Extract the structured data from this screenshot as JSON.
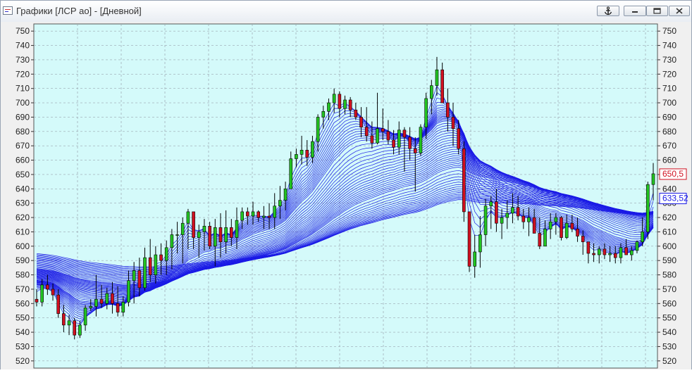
{
  "window": {
    "title": "Графики [ЛСР ао] - [Дневной]",
    "anchor_icon": "anchor-icon",
    "minimize_icon": "minimize-icon",
    "restore_icon": "restore-icon",
    "close_icon": "close-icon"
  },
  "chart_data": {
    "type": "candlestick",
    "ylim": [
      515,
      755
    ],
    "y_ticks": [
      520,
      530,
      540,
      550,
      560,
      570,
      580,
      590,
      600,
      610,
      620,
      630,
      640,
      650,
      660,
      670,
      680,
      690,
      700,
      710,
      720,
      730,
      740,
      750
    ],
    "grid": true,
    "colors": {
      "background": "#d4fafa",
      "up": "#22c422",
      "down": "#d01020",
      "ma": "#1a1ae6",
      "grid": "#9aa6b0"
    },
    "last_price_label": {
      "value": "650,5",
      "color": "#d01020"
    },
    "ma_price_label": {
      "value": "633,52",
      "color": "#1a1ae6"
    },
    "candles": [
      [
        563,
        570,
        558,
        561
      ],
      [
        561,
        577,
        558,
        573
      ],
      [
        573,
        580,
        566,
        570
      ],
      [
        570,
        574,
        562,
        566
      ],
      [
        566,
        570,
        550,
        553
      ],
      [
        553,
        559,
        540,
        545
      ],
      [
        545,
        552,
        538,
        548
      ],
      [
        548,
        550,
        535,
        538
      ],
      [
        538,
        548,
        536,
        545
      ],
      [
        545,
        559,
        541,
        557
      ],
      [
        557,
        563,
        555,
        558
      ],
      [
        558,
        580,
        551,
        563
      ],
      [
        563,
        573,
        557,
        560
      ],
      [
        560,
        571,
        556,
        567
      ],
      [
        567,
        575,
        553,
        560
      ],
      [
        560,
        572,
        551,
        554
      ],
      [
        554,
        565,
        551,
        561
      ],
      [
        561,
        583,
        558,
        576
      ],
      [
        576,
        589,
        560,
        583
      ],
      [
        583,
        592,
        565,
        571
      ],
      [
        571,
        599,
        569,
        592
      ],
      [
        592,
        605,
        575,
        580
      ],
      [
        580,
        600,
        574,
        594
      ],
      [
        594,
        602,
        580,
        590
      ],
      [
        590,
        604,
        580,
        599
      ],
      [
        599,
        612,
        584,
        608
      ],
      [
        608,
        617,
        595,
        608
      ],
      [
        608,
        620,
        588,
        616
      ],
      [
        616,
        626,
        598,
        624
      ],
      [
        624,
        620,
        598,
        606
      ],
      [
        606,
        615,
        592,
        610
      ],
      [
        610,
        619,
        597,
        614
      ],
      [
        614,
        617,
        598,
        600
      ],
      [
        600,
        619,
        586,
        613
      ],
      [
        613,
        623,
        592,
        603
      ],
      [
        603,
        625,
        595,
        613
      ],
      [
        613,
        619,
        600,
        606
      ],
      [
        606,
        627,
        598,
        618
      ],
      [
        618,
        627,
        612,
        624
      ],
      [
        624,
        627,
        615,
        621
      ],
      [
        621,
        631,
        615,
        624
      ],
      [
        624,
        625,
        617,
        620
      ],
      [
        620,
        628,
        612,
        621
      ],
      [
        621,
        630,
        612,
        620
      ],
      [
        620,
        637,
        612,
        628
      ],
      [
        628,
        642,
        619,
        632
      ],
      [
        632,
        645,
        625,
        640
      ],
      [
        640,
        666,
        640,
        661
      ],
      [
        661,
        668,
        655,
        664
      ],
      [
        664,
        677,
        657,
        667
      ],
      [
        667,
        674,
        656,
        662
      ],
      [
        662,
        677,
        658,
        673
      ],
      [
        673,
        692,
        666,
        690
      ],
      [
        690,
        698,
        682,
        694
      ],
      [
        694,
        703,
        688,
        700
      ],
      [
        700,
        710,
        693,
        706
      ],
      [
        706,
        708,
        690,
        696
      ],
      [
        696,
        705,
        692,
        702
      ],
      [
        702,
        704,
        690,
        695
      ],
      [
        695,
        700,
        688,
        690
      ],
      [
        690,
        697,
        676,
        683
      ],
      [
        683,
        697,
        673,
        677
      ],
      [
        677,
        687,
        668,
        672
      ],
      [
        672,
        707,
        671,
        682
      ],
      [
        682,
        696,
        674,
        680
      ],
      [
        680,
        688,
        671,
        674
      ],
      [
        674,
        681,
        664,
        669
      ],
      [
        669,
        687,
        664,
        681
      ],
      [
        681,
        683,
        652,
        676
      ],
      [
        676,
        683,
        660,
        668
      ],
      [
        668,
        676,
        638,
        665
      ],
      [
        665,
        685,
        663,
        683
      ],
      [
        683,
        707,
        675,
        703
      ],
      [
        703,
        716,
        692,
        712
      ],
      [
        712,
        732,
        705,
        723
      ],
      [
        723,
        728,
        700,
        700
      ],
      [
        700,
        710,
        680,
        690
      ],
      [
        690,
        700,
        670,
        682
      ],
      [
        682,
        688,
        664,
        668
      ],
      [
        668,
        673,
        617,
        624
      ],
      [
        624,
        610,
        582,
        586
      ],
      [
        586,
        608,
        578,
        596
      ],
      [
        596,
        621,
        585,
        608
      ],
      [
        608,
        633,
        600,
        628
      ],
      [
        628,
        635,
        612,
        631
      ],
      [
        631,
        640,
        610,
        616
      ],
      [
        616,
        626,
        605,
        620
      ],
      [
        620,
        632,
        612,
        623
      ],
      [
        623,
        637,
        616,
        627
      ],
      [
        627,
        635,
        618,
        621
      ],
      [
        621,
        626,
        612,
        617
      ],
      [
        617,
        627,
        607,
        620
      ],
      [
        620,
        626,
        610,
        609
      ],
      [
        609,
        620,
        598,
        600
      ],
      [
        600,
        618,
        600,
        612
      ],
      [
        612,
        623,
        605,
        617
      ],
      [
        617,
        623,
        608,
        620
      ],
      [
        620,
        621,
        604,
        606
      ],
      [
        606,
        622,
        605,
        616
      ],
      [
        616,
        622,
        610,
        612
      ],
      [
        612,
        620,
        603,
        607
      ],
      [
        607,
        611,
        594,
        603
      ],
      [
        603,
        598,
        588,
        595
      ],
      [
        595,
        602,
        589,
        594
      ],
      [
        594,
        600,
        588,
        598
      ],
      [
        598,
        602,
        591,
        594
      ],
      [
        594,
        600,
        589,
        595
      ],
      [
        595,
        600,
        588,
        592
      ],
      [
        592,
        602,
        588,
        599
      ],
      [
        599,
        605,
        596,
        594
      ],
      [
        594,
        600,
        590,
        597
      ],
      [
        597,
        604,
        595,
        603
      ],
      [
        603,
        620,
        600,
        610
      ],
      [
        610,
        645,
        605,
        643
      ],
      [
        643,
        658,
        632,
        650.5
      ]
    ]
  }
}
